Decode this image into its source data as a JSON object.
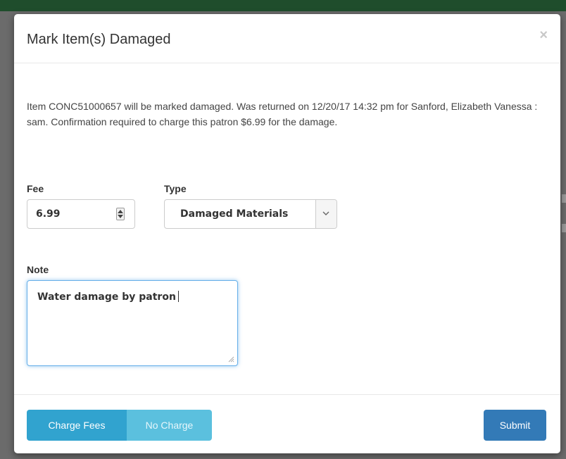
{
  "modal": {
    "title": "Mark Item(s) Damaged",
    "close_glyph": "×"
  },
  "message": "Item CONC51000657 will be marked damaged. Was returned on 12/20/17 14:32 pm for Sanford, Elizabeth Vanessa : sam. Confirmation required to charge this patron $6.99 for the damage.",
  "form": {
    "fee": {
      "label": "Fee",
      "value": "6.99"
    },
    "type": {
      "label": "Type",
      "selected": "Damaged Materials"
    },
    "note": {
      "label": "Note",
      "value": "Water damage by patron"
    }
  },
  "footer": {
    "charge_label": "Charge Fees",
    "no_charge_label": "No Charge",
    "submit_label": "Submit"
  },
  "icons": {
    "close": "close-icon",
    "spinner": "spinner-arrows-icon",
    "dropdown": "chevron-down-icon",
    "resize": "resize-grip-icon"
  },
  "colors": {
    "primary": "#337ab7",
    "info": "#5bc0de",
    "info_active": "#31a3cf",
    "focus": "#66afe9",
    "topbar": "#1f4d2c"
  }
}
